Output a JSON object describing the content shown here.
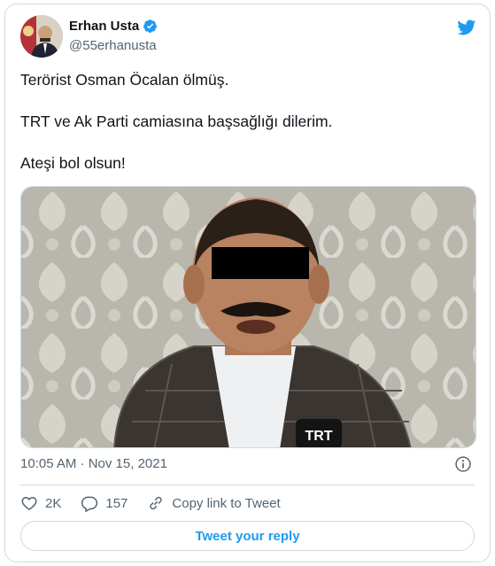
{
  "author": {
    "name": "Erhan Usta",
    "handle": "@55erhanusta",
    "verified": true
  },
  "tweet": {
    "lines": [
      "Terörist Osman Öcalan ölmüş.",
      "TRT ve Ak Parti camiasına başsağlığı dilerim.",
      "Ateşi bol olsun!"
    ],
    "media_overlay_text": "TRT",
    "timestamp": "10:05 AM · Nov 15, 2021"
  },
  "actions": {
    "likes": "2K",
    "replies": "157",
    "copy_link": "Copy link to Tweet"
  },
  "reply_button": "Tweet your reply",
  "colors": {
    "brand": "#1d9bf0",
    "text": "#0f1419",
    "muted": "#536471",
    "border": "#cfd9de"
  },
  "icons": [
    "twitter-bird-icon",
    "verified-badge-icon",
    "info-icon",
    "heart-icon",
    "reply-icon",
    "link-icon"
  ]
}
